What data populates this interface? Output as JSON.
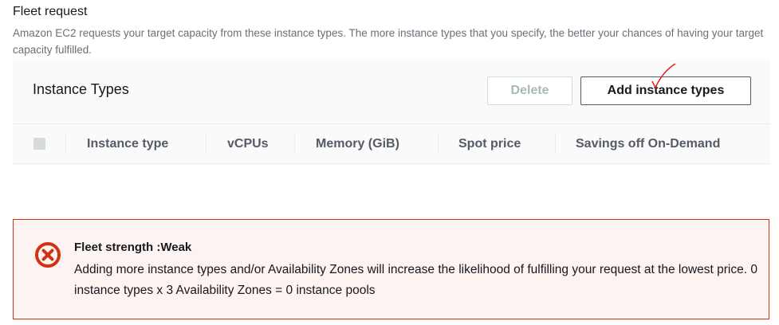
{
  "section": {
    "title": "Fleet request",
    "description": "Amazon EC2 requests your target capacity from these instance types. The more instance types that you specify, the better your chances of having your target capacity fulfilled."
  },
  "panel": {
    "title": "Instance Types",
    "delete_label": "Delete",
    "add_label": "Add instance types",
    "columns": [
      "Instance type",
      "vCPUs",
      "Memory (GiB)",
      "Spot price",
      "Savings off On-Demand"
    ]
  },
  "alert": {
    "icon": "error-circle-x-icon",
    "color": "#d13212",
    "title": "Fleet strength :Weak",
    "body": "Adding more instance types and/or Availability Zones will increase the likelihood of fulfilling your request at the lowest price. 0 instance types x 3 Availability Zones = 0 instance pools"
  }
}
